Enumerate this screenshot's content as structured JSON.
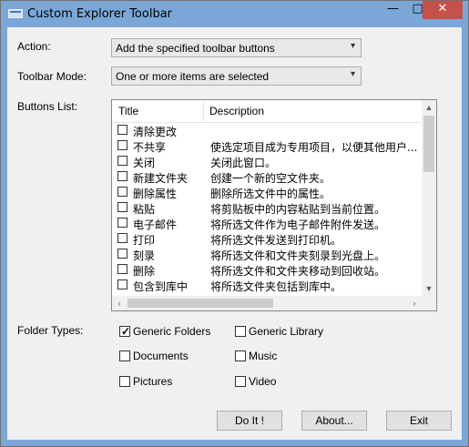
{
  "window": {
    "title": "Custom Explorer Toolbar",
    "minimize_glyph": "—",
    "maximize_glyph": "□",
    "close_glyph": "✕"
  },
  "action": {
    "label": "Action:",
    "value": "Add the specified toolbar buttons"
  },
  "toolbar_mode": {
    "label": "Toolbar Mode:",
    "value": "One or more items are selected"
  },
  "buttons_list": {
    "label": "Buttons List:",
    "columns": [
      "Title",
      "Description"
    ],
    "rows": [
      {
        "title": "清除更改",
        "description": ""
      },
      {
        "title": "不共享",
        "description": "使选定项目成为专用项目，以便其他用户..."
      },
      {
        "title": "关闭",
        "description": "关闭此窗口。"
      },
      {
        "title": "新建文件夹",
        "description": "创建一个新的空文件夹。"
      },
      {
        "title": "删除属性",
        "description": "删除所选文件中的属性。"
      },
      {
        "title": "粘贴",
        "description": "将剪贴板中的内容粘贴到当前位置。"
      },
      {
        "title": "电子邮件",
        "description": "将所选文件作为电子邮件附件发送。"
      },
      {
        "title": "打印",
        "description": "将所选文件发送到打印机。"
      },
      {
        "title": "刻录",
        "description": "将所选文件和文件夹刻录到光盘上。"
      },
      {
        "title": "删除",
        "description": "将所选文件和文件夹移动到回收站。"
      },
      {
        "title": "包含到库中",
        "description": "将所选文件夹包括到库中。"
      }
    ]
  },
  "folder_types": {
    "label": "Folder Types:",
    "options": [
      {
        "label": "Generic Folders",
        "checked": true
      },
      {
        "label": "Generic Library",
        "checked": false
      },
      {
        "label": "Documents",
        "checked": false
      },
      {
        "label": "Music",
        "checked": false
      },
      {
        "label": "Pictures",
        "checked": false
      },
      {
        "label": "Video",
        "checked": false
      }
    ]
  },
  "buttons": {
    "do_it": "Do It !",
    "about": "About...",
    "exit": "Exit"
  },
  "colors": {
    "titlebar": "#7aa7d8",
    "close_button": "#c7504b",
    "dialog_bg": "#f0f0f0"
  }
}
